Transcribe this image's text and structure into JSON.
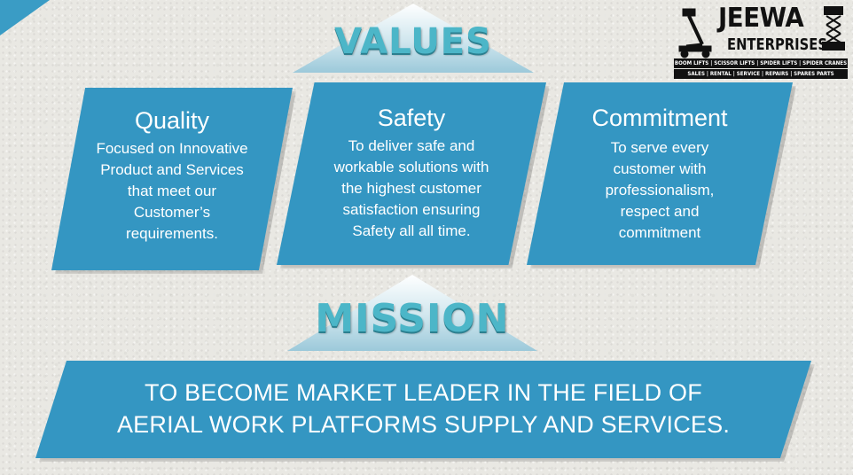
{
  "logo": {
    "name": "JEEWA",
    "subname": "ENTERPRISES",
    "tagline_products": "BOOM LIFTS | SCISSOR LIFTS | SPIDER LIFTS | SPIDER CRANES",
    "tagline_services": "SALES | RENTAL | SERVICE | REPAIRS | SPARES PARTS"
  },
  "values": {
    "heading": "VALUES",
    "cards": [
      {
        "title": "Quality",
        "lines": [
          "Focused on Innovative",
          "Product and Services",
          "that meet our",
          "Customer’s",
          "requirements."
        ]
      },
      {
        "title": "Safety",
        "lines": [
          "To deliver safe and",
          "workable solutions with",
          "the highest customer",
          "satisfaction ensuring",
          "Safety all all time."
        ]
      },
      {
        "title": "Commitment",
        "lines": [
          "To serve every",
          "customer with",
          "professionalism,",
          "respect and",
          "commitment"
        ]
      }
    ]
  },
  "mission": {
    "heading": "MISSION",
    "lines": [
      "TO BECOME MARKET LEADER IN THE FIELD OF",
      "AERIAL WORK PLATFORMS SUPPLY AND SERVICES."
    ]
  },
  "colors": {
    "accent": "#3496c2",
    "heading_text": "#4cb6c8",
    "background": "#e9e8e3"
  }
}
